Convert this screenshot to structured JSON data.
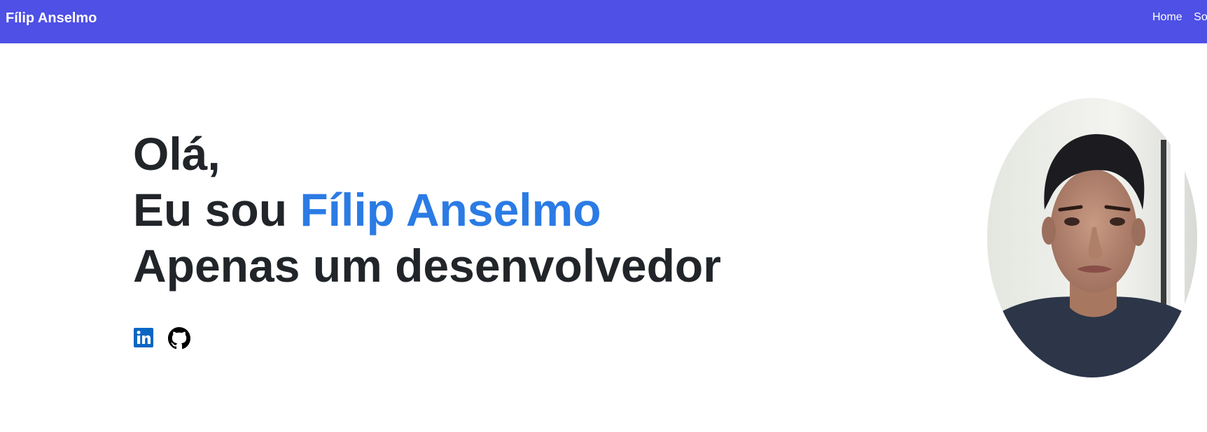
{
  "navbar": {
    "brand": "Fílip Anselmo",
    "links": [
      "Home",
      "Sobre"
    ],
    "background": "#4e50e6"
  },
  "hero": {
    "greeting": "Olá,",
    "intro_prefix": "Eu sou ",
    "name": "Fílip Anselmo",
    "tagline": "Apenas um desenvolvedor",
    "name_color": "#2b7be5"
  },
  "social": [
    {
      "icon": "linkedin-icon"
    },
    {
      "icon": "github-icon"
    }
  ],
  "avatar": {
    "icon": "profile-photo"
  }
}
